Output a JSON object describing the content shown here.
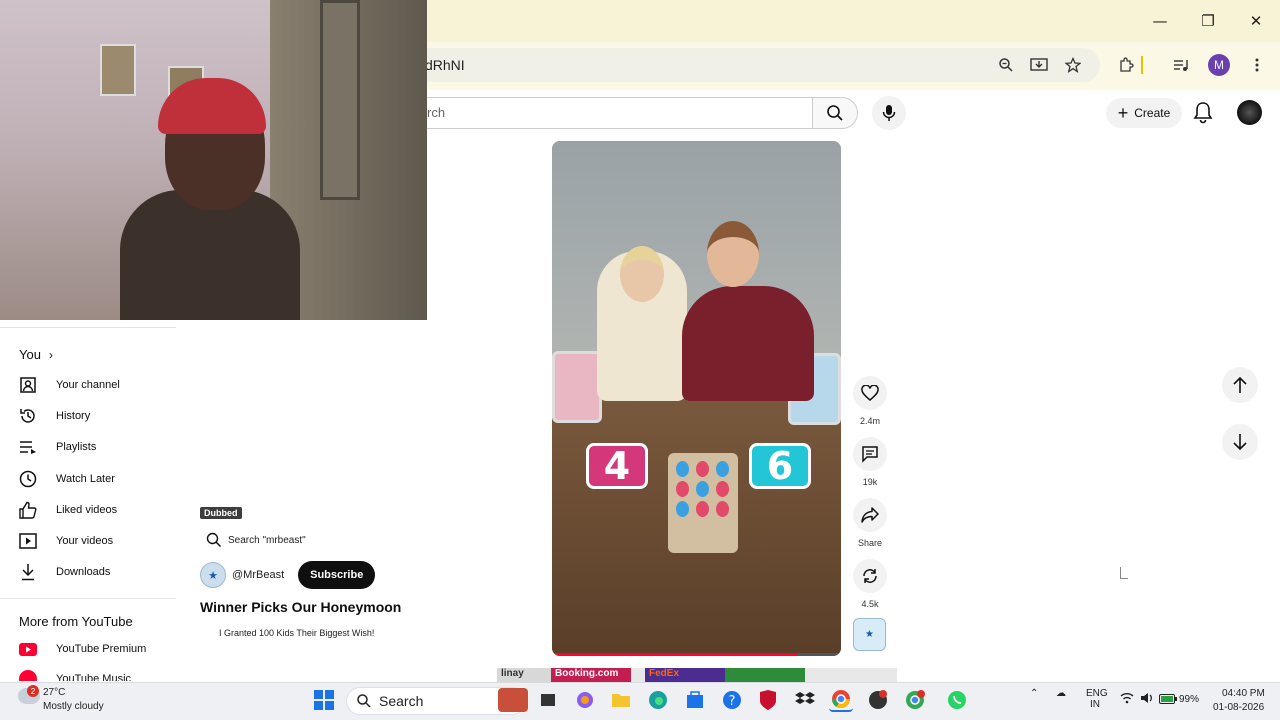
{
  "browser": {
    "url_fragment": "dRhNI",
    "profile_initial": "M",
    "window_controls": [
      "minimize",
      "restore",
      "close"
    ]
  },
  "youtube_header": {
    "search_placeholder": "rch",
    "create_label": "Create"
  },
  "sidebar": {
    "you_label": "You",
    "you_items": [
      {
        "icon": "person-box-icon",
        "label": "Your channel"
      },
      {
        "icon": "history-icon",
        "label": "History"
      },
      {
        "icon": "playlists-icon",
        "label": "Playlists"
      },
      {
        "icon": "clock-icon",
        "label": "Watch Later"
      },
      {
        "icon": "thumbs-up-icon",
        "label": "Liked videos"
      },
      {
        "icon": "play-box-icon",
        "label": "Your videos"
      },
      {
        "icon": "download-icon",
        "label": "Downloads"
      }
    ],
    "more_heading": "More from YouTube",
    "more_items": [
      {
        "icon": "youtube-premium-icon",
        "label": "YouTube Premium"
      },
      {
        "icon": "youtube-music-icon",
        "label": "YouTube Music"
      }
    ]
  },
  "short": {
    "dubbed_badge": "Dubbed",
    "search_suggestion": "Search \"mrbeast\"",
    "channel_handle": "@MrBeast",
    "subscribe_label": "Subscribe",
    "title": "Winner Picks Our Honeymoon",
    "related_video": "I Granted 100 Kids Their Biggest Wish!",
    "score_left": "4",
    "score_right": "6",
    "progress_fraction": 0.85
  },
  "actions": {
    "likes": "2.4m",
    "comments": "19k",
    "share": "Share",
    "remix": "4.5k"
  },
  "next_strip": [
    "linay",
    "Booking.com",
    "FedEx",
    ""
  ],
  "taskbar": {
    "weather_badge": "2",
    "temperature": "27°C",
    "condition": "Mostly cloudy",
    "search_label": "Search",
    "language_top": "ENG",
    "language_bottom": "IN",
    "battery": "99%",
    "time": "04:40 PM",
    "date": "01-08-2026"
  },
  "colors": {
    "browser_titlebar": "#f7f3d6",
    "youtube_red": "#ff0033",
    "score_pink": "#d4387a",
    "score_cyan": "#23c6d6"
  }
}
